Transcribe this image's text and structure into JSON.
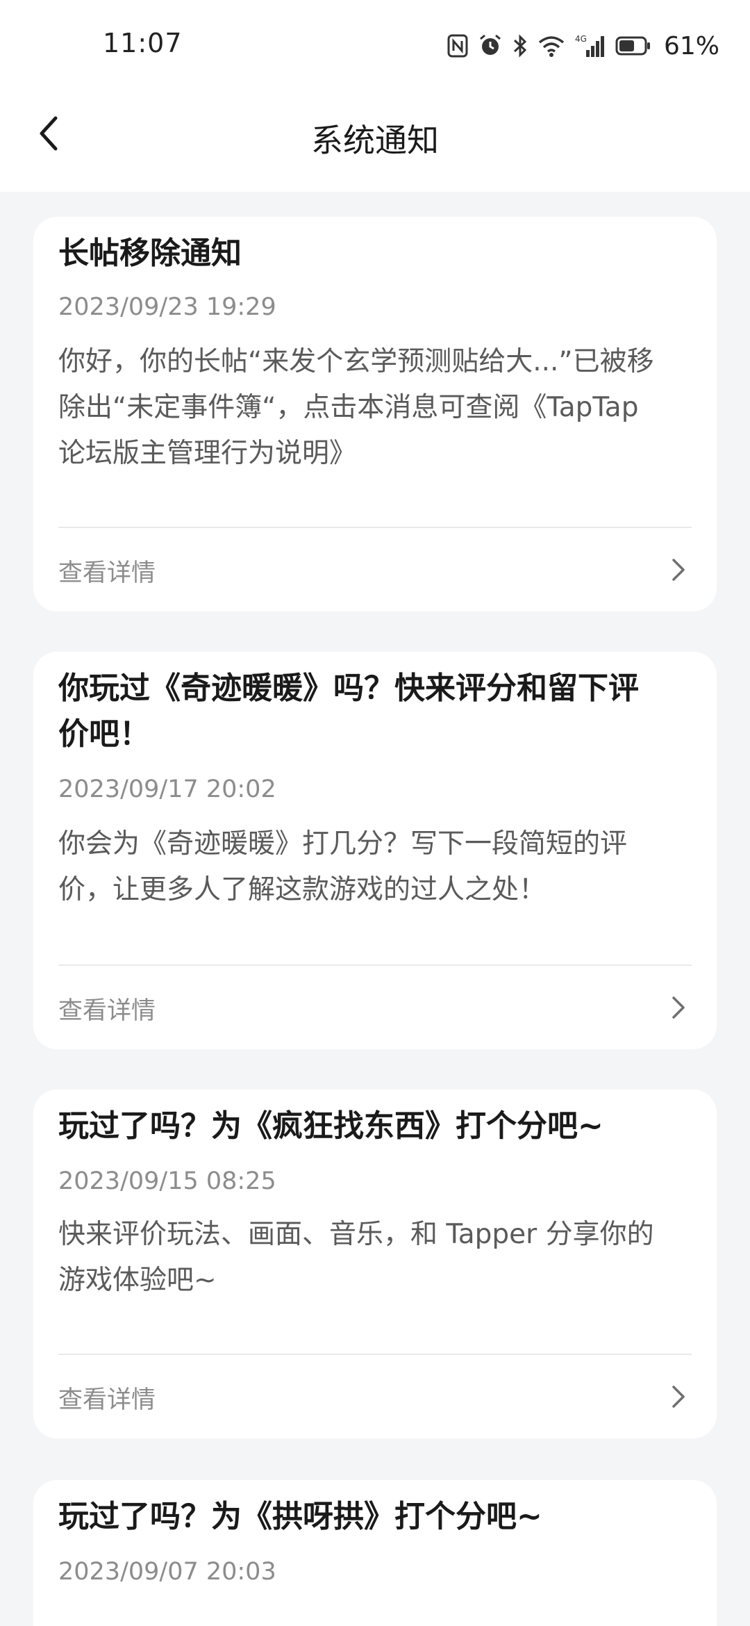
{
  "status_bar": {
    "time": "11:07",
    "icons": [
      "nfc-icon",
      "alarm-icon",
      "bluetooth-icon",
      "wifi-icon",
      "signal-4g-icon",
      "battery-icon"
    ],
    "network_label": "4G",
    "battery_percent": "61%",
    "battery_level": 0.61
  },
  "nav": {
    "back_icon": "chevron-left-icon",
    "title": "系统通知"
  },
  "notifications": [
    {
      "title": "长帖移除通知",
      "date": "2023/09/23 19:29",
      "body_lines": [
        "你好，你的长帖“来发个玄学预测贴给大...”已被移",
        "除出“未定事件簿“，点击本消息可查阅《TapTap",
        "论坛版主管理行为说明》"
      ],
      "action": "查看详情"
    },
    {
      "title_lines": [
        "你玩过《奇迹暖暖》吗？快来评分和留下评",
        "价吧！"
      ],
      "date": "2023/09/17 20:02",
      "body_lines": [
        "你会为《奇迹暖暖》打几分？写下一段简短的评",
        "价，让更多人了解这款游戏的过人之处！"
      ],
      "action": "查看详情"
    },
    {
      "title": "玩过了吗？为《疯狂找东西》打个分吧~",
      "date": "2023/09/15 08:25",
      "body_lines": [
        "快来评价玩法、画面、音乐，和 Tapper 分享你的",
        "游戏体验吧~"
      ],
      "action": "查看详情"
    },
    {
      "title": "玩过了吗？为《拱呀拱》打个分吧~",
      "date": "2023/09/07 20:03"
    }
  ],
  "chevron_icon": "chevron-right-icon"
}
